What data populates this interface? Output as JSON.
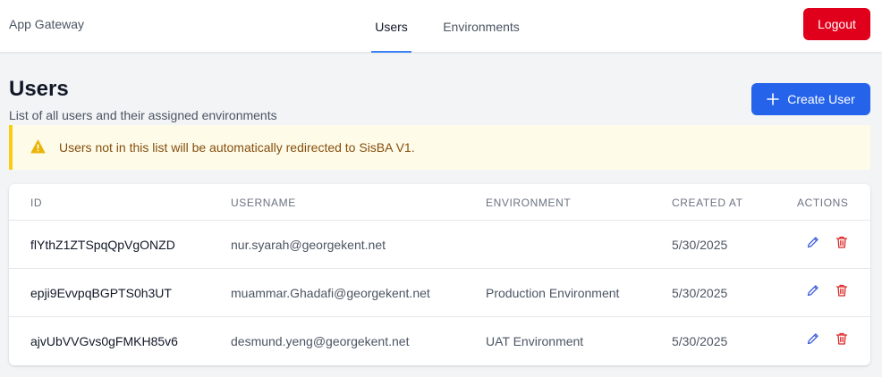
{
  "nav": {
    "brand": "App Gateway",
    "tabs": [
      {
        "label": "Users",
        "active": true
      },
      {
        "label": "Environments",
        "active": false
      }
    ],
    "logout_label": "Logout"
  },
  "header": {
    "title": "Users",
    "subtitle": "List of all users and their assigned environments",
    "create_label": "Create User"
  },
  "alert": {
    "text": "Users not in this list will be automatically redirected to SisBA V1."
  },
  "table": {
    "columns": [
      "ID",
      "Username",
      "Environment",
      "Created At",
      "Actions"
    ],
    "rows": [
      {
        "id": "flYthZ1ZTSpqQpVgONZD",
        "username": "nur.syarah@georgekent.net",
        "environment": "",
        "created_at": "5/30/2025"
      },
      {
        "id": "epji9EvvpqBGPTS0h3UT",
        "username": "muammar.Ghadafi@georgekent.net",
        "environment": "Production Environment",
        "created_at": "5/30/2025"
      },
      {
        "id": "ajvUbVVGvs0gFMKH85v6",
        "username": "desmund.yeng@georgekent.net",
        "environment": "UAT Environment",
        "created_at": "5/30/2025"
      }
    ]
  },
  "icons": {
    "plus": "plus-icon",
    "warning": "warning-icon",
    "edit": "pencil-icon",
    "delete": "trash-icon"
  },
  "colors": {
    "primary": "#2563eb",
    "danger": "#e0001b",
    "warning_bg": "#fefce8",
    "warning_border": "#facc15",
    "warning_text": "#854d0e",
    "edit_icon": "#3b5bdb",
    "delete_icon": "#dc2626"
  }
}
